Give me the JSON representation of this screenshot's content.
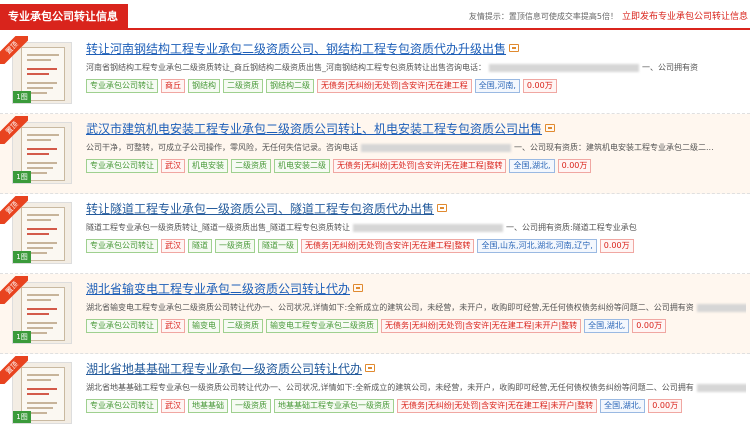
{
  "header": {
    "title": "专业承包公司转让信息",
    "tip_text": "友情提示：置顶信息可使成交率提高5倍！",
    "tip_link": "立即发布专业承包公司转让信息"
  },
  "badge_label": "置顶",
  "listings": [
    {
      "title": "转让河南钢结构工程专业承包二级资质公司、钢结构工程专包资质代办升级出售",
      "desc": "河南省钢结构工程专业承包二级资质转让_商丘钢结构二级资质出售_河南钢结构工程专包资质转让出售咨询电话：",
      "desc_tail": "一、公司拥有资",
      "photo_count": "1图",
      "tags": [
        {
          "text": "专业承包公司转让",
          "c": "tg"
        },
        {
          "text": "商丘",
          "c": "tr"
        },
        {
          "text": "钢结构",
          "c": "tg"
        },
        {
          "text": "二级资质",
          "c": "tg"
        },
        {
          "text": "钢结构二级",
          "c": "tg"
        },
        {
          "text": "无债务|无纠纷|无处罚|含安许|无在建工程",
          "c": "tr"
        },
        {
          "text": "全国,河南,",
          "c": "tb"
        },
        {
          "text": "0.00万",
          "c": "tr"
        }
      ]
    },
    {
      "title": "武汉市建筑机电安装工程专业承包二级资质公司转让、机电安装工程专包资质公司出售",
      "desc": "公司干净，可整转，可成立子公司操作，零风险，无任何失信记录。咨询电话",
      "desc_tail": "一、公司现有资质：建筑机电安装工程专业承包二级二...",
      "photo_count": "1图",
      "tags": [
        {
          "text": "专业承包公司转让",
          "c": "tg"
        },
        {
          "text": "武汉",
          "c": "tr"
        },
        {
          "text": "机电安装",
          "c": "tg"
        },
        {
          "text": "二级资质",
          "c": "tg"
        },
        {
          "text": "机电安装二级",
          "c": "tg"
        },
        {
          "text": "无债务|无纠纷|无处罚|含安许|无在建工程|整转",
          "c": "tr"
        },
        {
          "text": "全国,湖北,",
          "c": "tb"
        },
        {
          "text": "0.00万",
          "c": "tr"
        }
      ]
    },
    {
      "title": "转让隧道工程专业承包一级资质公司、隧道工程专包资质代办出售",
      "desc": "隧道工程专业承包一级资质转让_隧道一级资质出售_隧道工程专包资质转让",
      "desc_tail": "一、公司拥有资质:隧道工程专业承包",
      "photo_count": "1图",
      "tags": [
        {
          "text": "专业承包公司转让",
          "c": "tg"
        },
        {
          "text": "武汉",
          "c": "tr"
        },
        {
          "text": "隧道",
          "c": "tg"
        },
        {
          "text": "一级资质",
          "c": "tg"
        },
        {
          "text": "隧道一级",
          "c": "tg"
        },
        {
          "text": "无债务|无纠纷|无处罚|含安许|无在建工程|整转",
          "c": "tr"
        },
        {
          "text": "全国,山东,河北,湖北,河南,辽宁,",
          "c": "tb"
        },
        {
          "text": "0.00万",
          "c": "tr"
        }
      ]
    },
    {
      "title": "湖北省输变电工程专业承包二级资质公司转让代办",
      "desc": "湖北省输变电工程专业承包二级资质公司转让代办一、公司状况,详情如下:全新成立的建筑公司，未经营，未开户，收购即可经营,无任何债权债务纠纷等问题二、公司拥有资",
      "desc_tail": "",
      "photo_count": "1图",
      "tags": [
        {
          "text": "专业承包公司转让",
          "c": "tg"
        },
        {
          "text": "武汉",
          "c": "tr"
        },
        {
          "text": "输变电",
          "c": "tg"
        },
        {
          "text": "二级资质",
          "c": "tg"
        },
        {
          "text": "输变电工程专业承包二级资质",
          "c": "tg"
        },
        {
          "text": "无债务|无纠纷|无处罚|含安许|无在建工程|未开户|整转",
          "c": "tr"
        },
        {
          "text": "全国,湖北,",
          "c": "tb"
        },
        {
          "text": "0.00万",
          "c": "tr"
        }
      ]
    },
    {
      "title": "湖北省地基基础工程专业承包一级资质公司转让代办",
      "desc": "湖北省地基基础工程专业承包一级资质公司转让代办一、公司状况,详情如下:全新成立的建筑公司，未经营，未开户，收购即可经营,无任何债权债务纠纷等问题二、公司拥有",
      "desc_tail": "",
      "photo_count": "1图",
      "tags": [
        {
          "text": "专业承包公司转让",
          "c": "tg"
        },
        {
          "text": "武汉",
          "c": "tr"
        },
        {
          "text": "地基基础",
          "c": "tg"
        },
        {
          "text": "一级资质",
          "c": "tg"
        },
        {
          "text": "地基基础工程专业承包一级资质",
          "c": "tg"
        },
        {
          "text": "无债务|无纠纷|无处罚|含安许|无在建工程|未开户|整转",
          "c": "tr"
        },
        {
          "text": "全国,湖北,",
          "c": "tb"
        },
        {
          "text": "0.00万",
          "c": "tr"
        }
      ]
    }
  ]
}
